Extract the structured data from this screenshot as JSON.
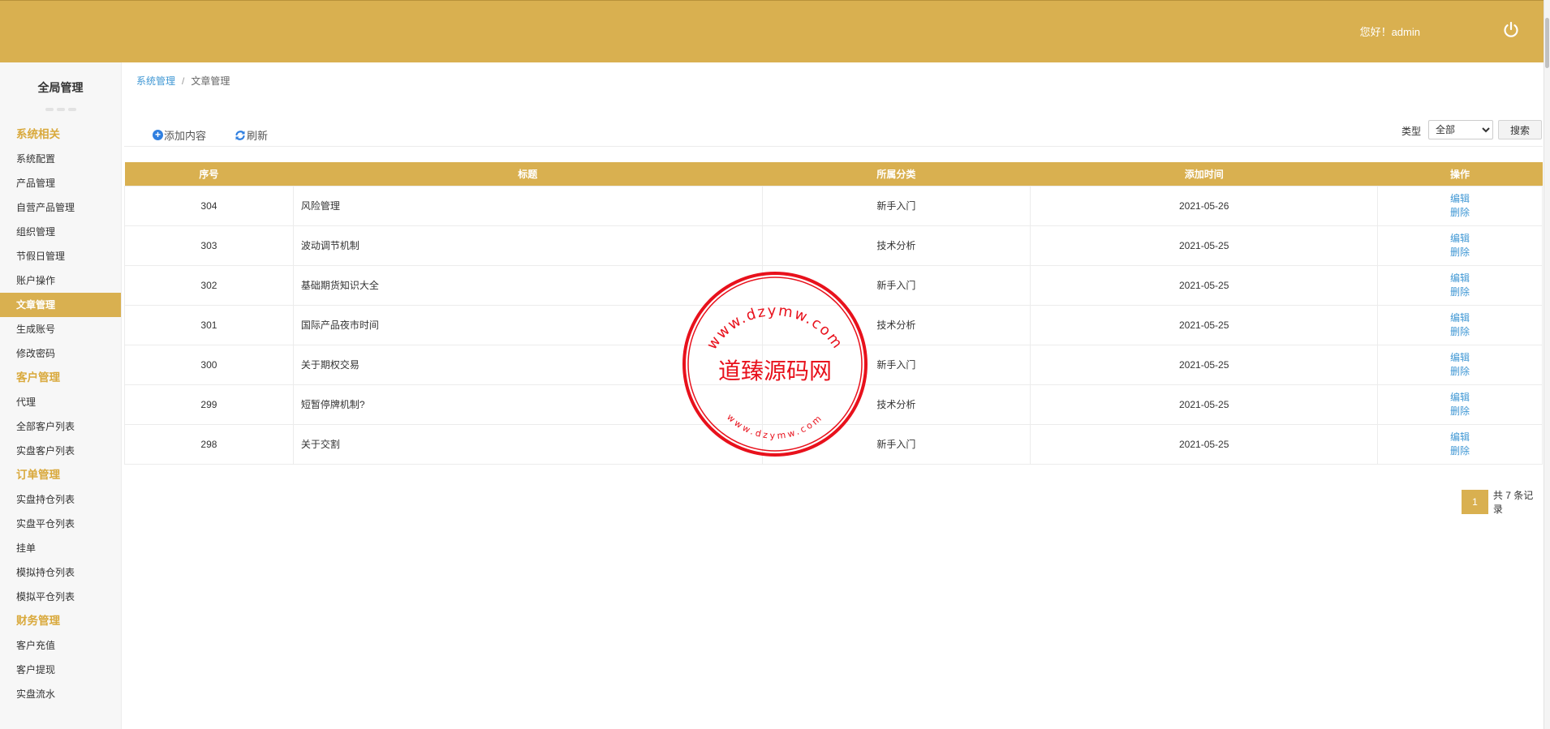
{
  "header": {
    "greeting": "您好！admin",
    "bg_color": "#d9b050"
  },
  "sidebar": {
    "title": "全局管理",
    "accent": "#d9a93c",
    "groups": [
      {
        "label": "系统相关",
        "items": [
          "系统配置",
          "产品管理",
          "自营产品管理",
          "组织管理",
          "节假日管理",
          "账户操作",
          "文章管理",
          "生成账号",
          "修改密码"
        ]
      },
      {
        "label": "客户管理",
        "items": [
          "代理",
          "全部客户列表",
          "实盘客户列表"
        ]
      },
      {
        "label": "订单管理",
        "items": [
          "实盘持仓列表",
          "实盘平仓列表",
          "挂单",
          "模拟持仓列表",
          "模拟平仓列表"
        ]
      },
      {
        "label": "财务管理",
        "items": [
          "客户充值",
          "客户提现",
          "实盘流水"
        ]
      }
    ],
    "active_item": "文章管理"
  },
  "breadcrumb": {
    "parent": "系统管理",
    "separator": "/",
    "current": "文章管理"
  },
  "toolbar": {
    "add_label": "添加内容",
    "refresh_label": "刷新",
    "type_label": "类型",
    "type_selected": "全部",
    "search_label": "搜索"
  },
  "table": {
    "headers": [
      "序号",
      "标题",
      "所属分类",
      "添加时间",
      "操作"
    ],
    "rows": [
      {
        "id": "304",
        "title": "风险管理",
        "category": "新手入门",
        "date": "2021-05-26",
        "edit": "编辑",
        "delete": "删除"
      },
      {
        "id": "303",
        "title": "波动调节机制",
        "category": "技术分析",
        "date": "2021-05-25",
        "edit": "编辑",
        "delete": "删除"
      },
      {
        "id": "302",
        "title": "基础期货知识大全",
        "category": "新手入门",
        "date": "2021-05-25",
        "edit": "编辑",
        "delete": "删除"
      },
      {
        "id": "301",
        "title": "国际产品夜市时间",
        "category": "技术分析",
        "date": "2021-05-25",
        "edit": "编辑",
        "delete": "删除"
      },
      {
        "id": "300",
        "title": "关于期权交易",
        "category": "新手入门",
        "date": "2021-05-25",
        "edit": "编辑",
        "delete": "删除"
      },
      {
        "id": "299",
        "title": "短暂停牌机制?",
        "category": "技术分析",
        "date": "2021-05-25",
        "edit": "编辑",
        "delete": "删除"
      },
      {
        "id": "298",
        "title": "关于交割",
        "category": "新手入门",
        "date": "2021-05-25",
        "edit": "编辑",
        "delete": "删除"
      }
    ]
  },
  "pagination": {
    "current_page": "1",
    "total_text": "共 7 条记录"
  },
  "watermark": {
    "center_text": "道臻源码网",
    "ring_top": "www.dzymw.com",
    "ring_bottom": "www.dzymw.com",
    "color": "#e8111c"
  }
}
